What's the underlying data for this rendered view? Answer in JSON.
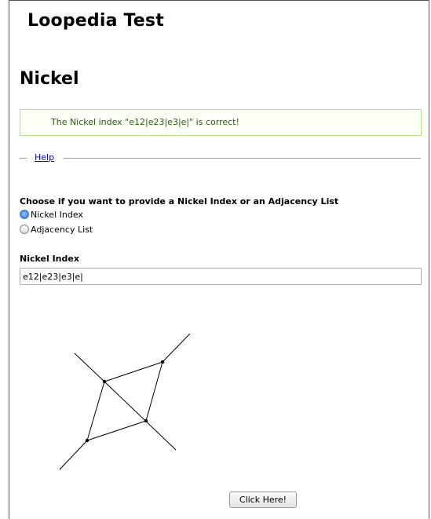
{
  "header": {
    "site_title": "Loopedia Test"
  },
  "page": {
    "title": "Nickel"
  },
  "alert": {
    "message": "The Nickel index \"e12|e23|e3|e|\" is correct!"
  },
  "help": {
    "toggle_label": "–",
    "link_label": "Help"
  },
  "form": {
    "mode_question": "Choose if you want to provide a Nickel Index or an Adjacency List",
    "mode_options": [
      {
        "label": "Nickel Index",
        "selected": true
      },
      {
        "label": "Adjacency List",
        "selected": false
      }
    ],
    "nickel_label": "Nickel Index",
    "nickel_value": "e12|e23|e3|e|"
  },
  "submit": {
    "label": "Click Here!"
  },
  "colors": {
    "success_border": "#b6e28a",
    "success_text": "#2a5a10",
    "link": "#0000cc"
  }
}
